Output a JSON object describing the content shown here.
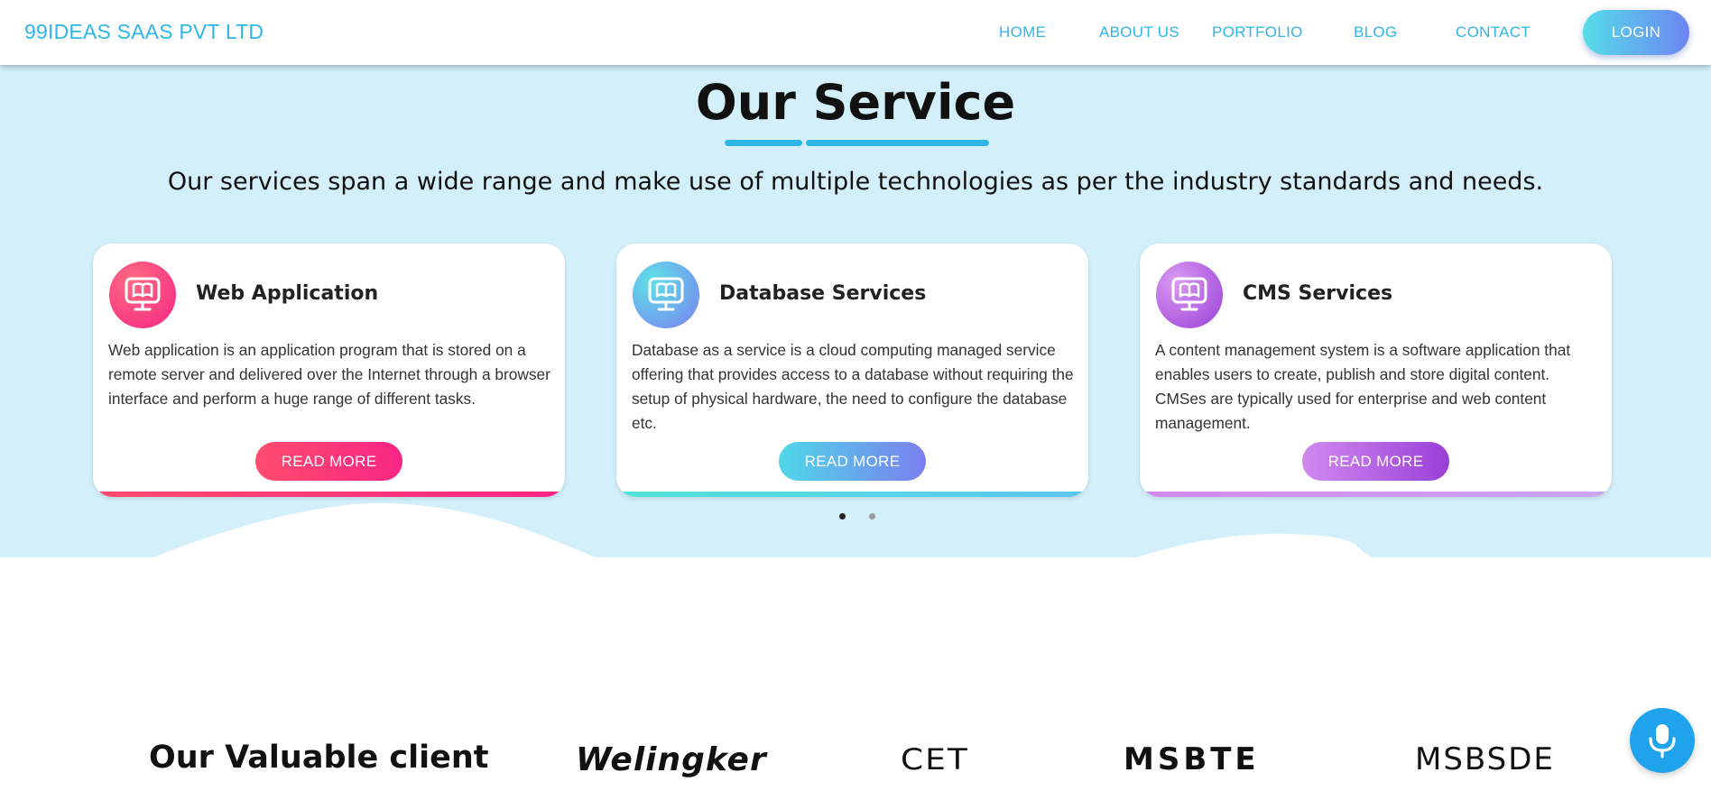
{
  "nav": {
    "brand": "99IDEAS SAAS PVT LTD",
    "links": [
      "HOME",
      "ABOUT US",
      "PORTFOLIO",
      "BLOG",
      "CONTACT"
    ],
    "login": "LOGIN"
  },
  "service": {
    "title": "Our Service",
    "subtitle": "Our services span a wide range and make use of multiple technologies as per the industry standards and needs.",
    "cards": [
      {
        "title": "Web Application",
        "desc": "Web application is an application program that is stored on a remote server and delivered over the Internet through a browser interface and perform a huge range of different tasks.",
        "button": "READ MORE",
        "icon": "monitor-book-icon",
        "colors": [
          "#ff4d6d",
          "#f72585"
        ]
      },
      {
        "title": "Database Services",
        "desc": "Database as a service is a cloud computing managed service offering that provides access to a database without requiring the setup of physical hardware, the need to configure the database etc.",
        "button": "READ MORE",
        "icon": "monitor-book-icon",
        "colors": [
          "#4fd8e8",
          "#7b7ff0"
        ]
      },
      {
        "title": "CMS Services",
        "desc": "A content management system is a software application that enables users to create, publish and store digital content. CMSes are typically used for enterprise and web content management.",
        "button": "READ MORE",
        "icon": "monitor-book-icon",
        "colors": [
          "#d18af0",
          "#9a3fd6"
        ]
      }
    ],
    "carousel": {
      "pages": 2,
      "active": 1
    }
  },
  "clients": {
    "title": "Our Valuable client",
    "logos": [
      "Welingker",
      "CET",
      "MSBTE",
      "MSBSDE"
    ]
  },
  "colors": {
    "accent": "#2fb6e7",
    "section_bg": "#d3f0fa",
    "mic": "#1fa3ec"
  }
}
